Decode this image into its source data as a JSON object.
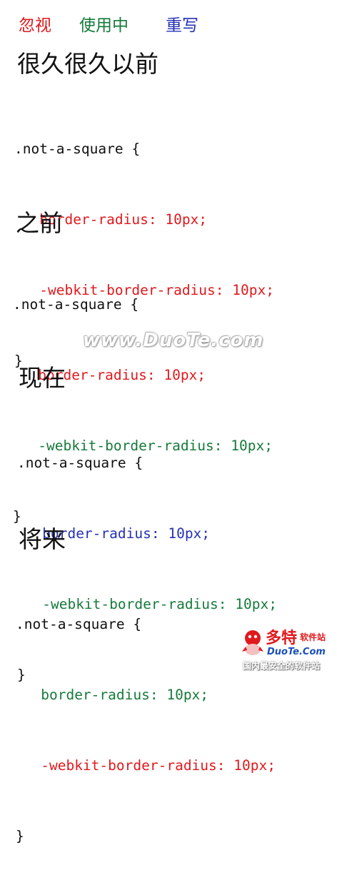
{
  "legend": {
    "ignore": "忽视",
    "in_use": "使用中",
    "rewrite": "重写"
  },
  "colors": {
    "ignore": "#e0191d",
    "in_use": "#167a3a",
    "rewrite": "#2431b5"
  },
  "sections": [
    {
      "heading": "很久很久以前",
      "selector": ".not-a-square {",
      "line1": "border-radius: 10px;",
      "line2": "-webkit-border-radius: 10px;",
      "close": "}"
    },
    {
      "heading": "之前",
      "selector": ".not-a-square {",
      "line1": "border-radius: 10px;",
      "line2": "-webkit-border-radius: 10px;",
      "close": "}"
    },
    {
      "heading": "现在",
      "selector": ".not-a-square {",
      "line1": "border-radius: 10px;",
      "line2": "-webkit-border-radius: 10px;",
      "close": "}"
    },
    {
      "heading": "将来",
      "selector": ".not-a-square {",
      "line1": "border-radius: 10px;",
      "line2": "-webkit-border-radius: 10px;",
      "close": "}"
    }
  ],
  "watermark": "www.DuoTe.com",
  "logo": {
    "cn": "多特",
    "cn_small": "软件站",
    "brand": "DuoTe.Com",
    "tagline": "国内最安全的软件站"
  }
}
